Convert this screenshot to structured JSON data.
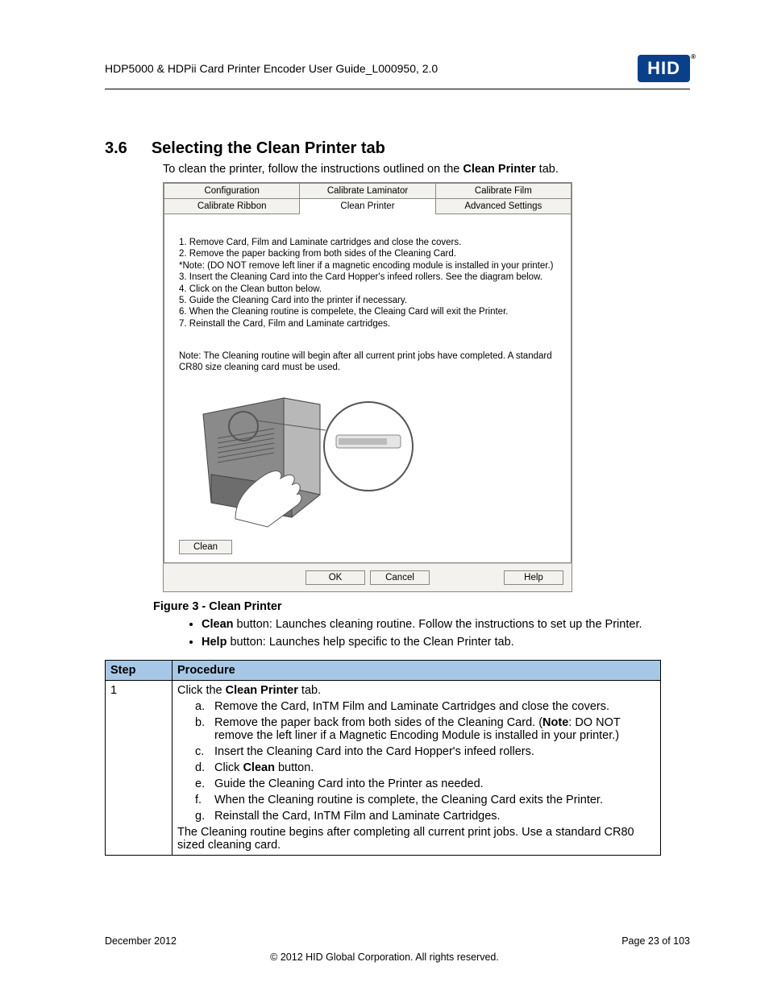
{
  "header": {
    "title": "HDP5000 & HDPii Card Printer Encoder User Guide_L000950, 2.0",
    "logo": "HID"
  },
  "section": {
    "number": "3.6",
    "title": "Selecting the Clean Printer tab",
    "intro_pre": "To clean the printer, follow the instructions outlined on the ",
    "intro_bold": "Clean Printer",
    "intro_post": " tab."
  },
  "dialog": {
    "tabs_row1": [
      "Configuration",
      "Calibrate Laminator",
      "Calibrate Film"
    ],
    "tabs_row2": [
      "Calibrate Ribbon",
      "Clean Printer",
      "Advanced Settings"
    ],
    "active_tab": "Clean Printer",
    "instructions": [
      "1. Remove Card, Film and Laminate cartridges and close the covers.",
      "2. Remove the paper backing from both sides of the Cleaning Card.",
      "*Note: (DO NOT remove left liner if a magnetic encoding module is installed in your printer.)",
      "3. Insert the Cleaning Card into the Card Hopper's infeed rollers. See the diagram below.",
      "4. Click on the Clean button below.",
      "5. Guide the Cleaning Card into the printer if necessary.",
      "6. When the Cleaning routine is compelete, the Cleaing Card will exit the Printer.",
      "7. Reinstall the Card, Film and Laminate cartridges."
    ],
    "note": "Note: The Cleaning routine will begin after all current print jobs have completed.  A standard CR80 size cleaning card must be used.",
    "buttons": {
      "clean": "Clean",
      "ok": "OK",
      "cancel": "Cancel",
      "help": "Help"
    }
  },
  "caption": "Figure 3 - Clean Printer",
  "bullets": [
    {
      "bold": "Clean",
      "rest": " button:  Launches cleaning routine. Follow the instructions to set up the Printer."
    },
    {
      "bold": "Help",
      "rest": " button:  Launches help specific to the Clean Printer tab."
    }
  ],
  "table": {
    "head": [
      "Step",
      "Procedure"
    ],
    "rows": [
      {
        "step": "1",
        "lead_pre": "Click the ",
        "lead_bold": "Clean Printer",
        "lead_post": " tab.",
        "items": [
          {
            "l": "a.",
            "t": "Remove the Card, InTM Film and Laminate Cartridges and close the covers."
          },
          {
            "l": "b.",
            "t_pre": "Remove the paper back from both sides of the Cleaning Card. (",
            "t_bold": "Note",
            "t_post": ": DO NOT remove the left liner if a Magnetic Encoding Module is installed in your printer.)"
          },
          {
            "l": "c.",
            "t": "Insert the Cleaning Card into the Card Hopper's infeed rollers."
          },
          {
            "l": "d.",
            "t_pre": "Click ",
            "t_bold": "Clean",
            "t_post": " button."
          },
          {
            "l": "e.",
            "t": "Guide the Cleaning Card into the Printer as needed."
          },
          {
            "l": "f.",
            "t": "When the Cleaning routine is complete, the Cleaning Card exits the Printer."
          },
          {
            "l": "g.",
            "t": "Reinstall the Card, InTM Film and Laminate Cartridges."
          }
        ],
        "trail": "The Cleaning routine begins after completing all current print jobs. Use a standard CR80 sized cleaning card."
      }
    ]
  },
  "footer": {
    "date": "December 2012",
    "page": "Page 23 of 103",
    "copyright": "© 2012 HID Global Corporation. All rights reserved."
  }
}
